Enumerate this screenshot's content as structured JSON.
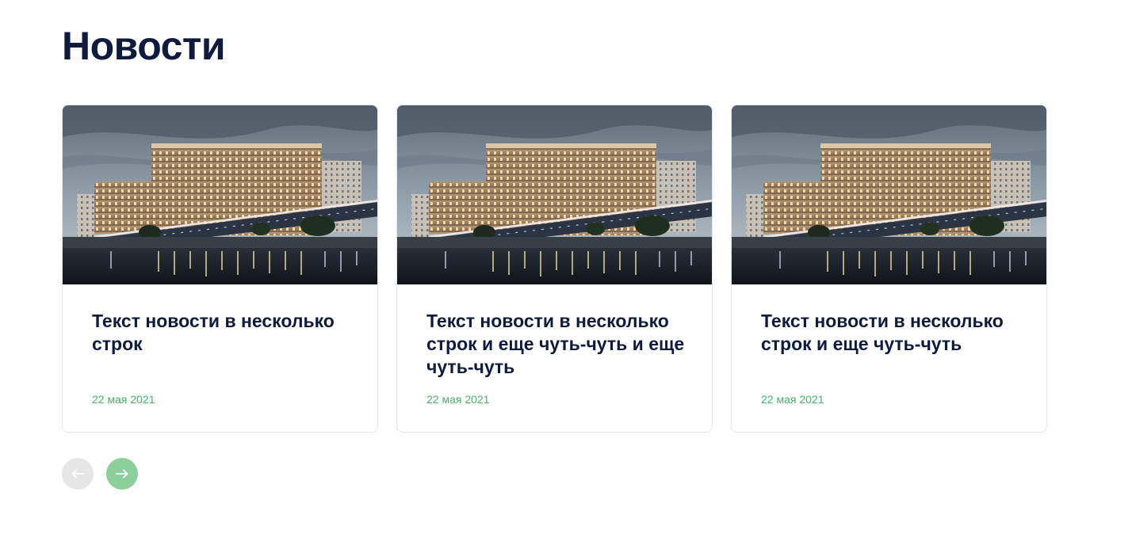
{
  "section": {
    "title": "Новости"
  },
  "colors": {
    "title": "#0f1b3d",
    "date": "#45b368",
    "nav_next": "#8bd09b",
    "nav_prev": "#e6e6e6"
  },
  "news": [
    {
      "title": "Текст новости в несколько строк",
      "date": "22 мая 2021",
      "image": "building-riverfront-photo"
    },
    {
      "title": "Текст новости в несколько строк и еще чуть-чуть и еще чуть-чуть",
      "date": "22 мая 2021",
      "image": "building-riverfront-photo"
    },
    {
      "title": "Текст новости в несколько строк и еще чуть-чуть",
      "date": "22 мая 2021",
      "image": "building-riverfront-photo"
    }
  ],
  "pagination": {
    "prev_icon": "arrow-left-icon",
    "next_icon": "arrow-right-icon"
  }
}
